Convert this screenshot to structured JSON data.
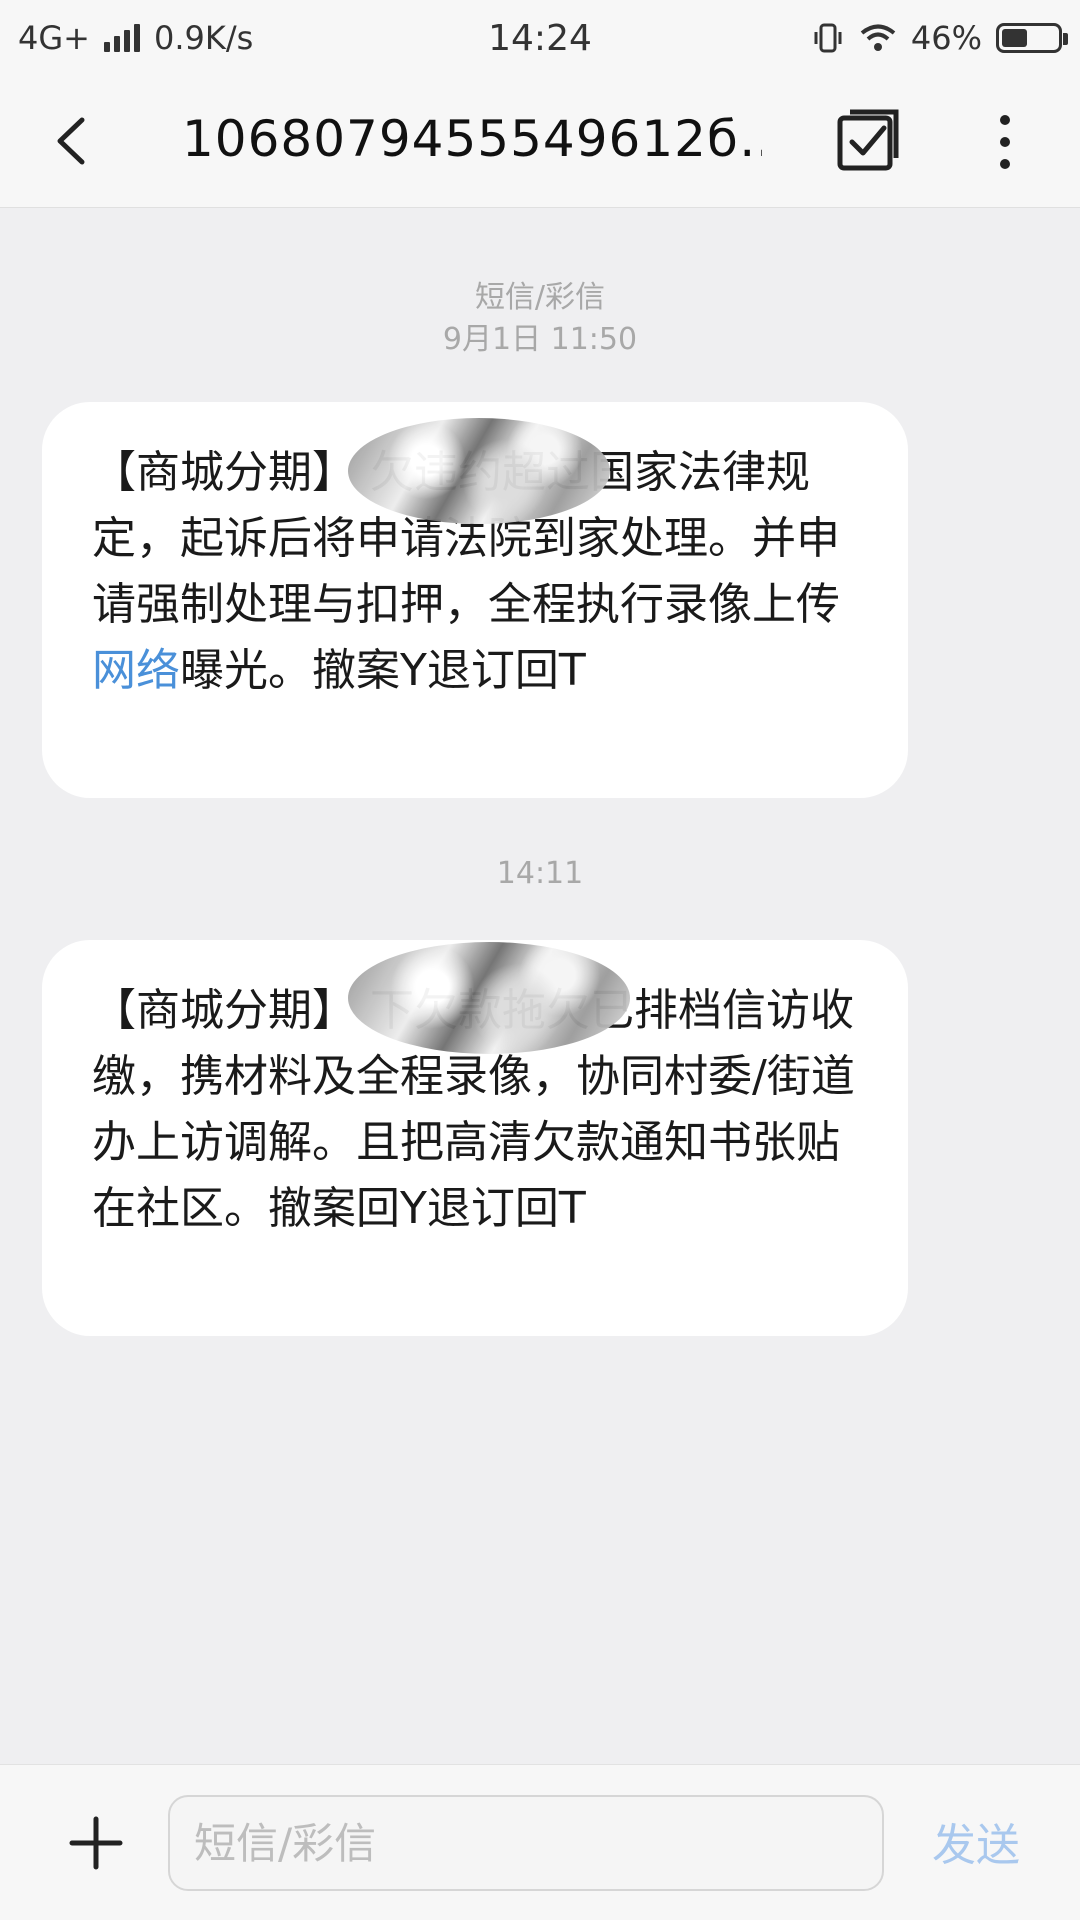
{
  "status_bar": {
    "network": "4G+",
    "speed": "0.9K/s",
    "time": "14:24",
    "battery": "46%",
    "battery_level": 0.46
  },
  "header": {
    "title": "1068079455549612б…",
    "back_icon": "chevron-left-icon",
    "select_icon": "checkbox-square-icon",
    "more_icon": "more-vertical-icon"
  },
  "conversation": {
    "channel_label": "短信/彩信",
    "messages": [
      {
        "timestamp": "9月1日 11:50",
        "text_before_link": "【商城分期】                   欠违约超过国家法律规定，起诉后将申请法院到家处理。并申请强制处理与扣押，全程执行录像上传",
        "link": "网络",
        "text_after_link": "曝光。撤案Y退订回T"
      },
      {
        "timestamp": "14:11",
        "text": "【商城分期】                     下欠款拖欠已排档信访收缴，携材料及全程录像，协同村委/街道办上访调解。且把高清欠款通知书张贴在社区。撤案回Y退订回T"
      }
    ]
  },
  "composer": {
    "placeholder": "短信/彩信",
    "send_label": "发送",
    "plus_icon": "plus-icon"
  },
  "colors": {
    "background": "#efeff1",
    "bubble": "#ffffff",
    "link": "#4a90d9",
    "send_disabled": "#a9c8ee"
  }
}
